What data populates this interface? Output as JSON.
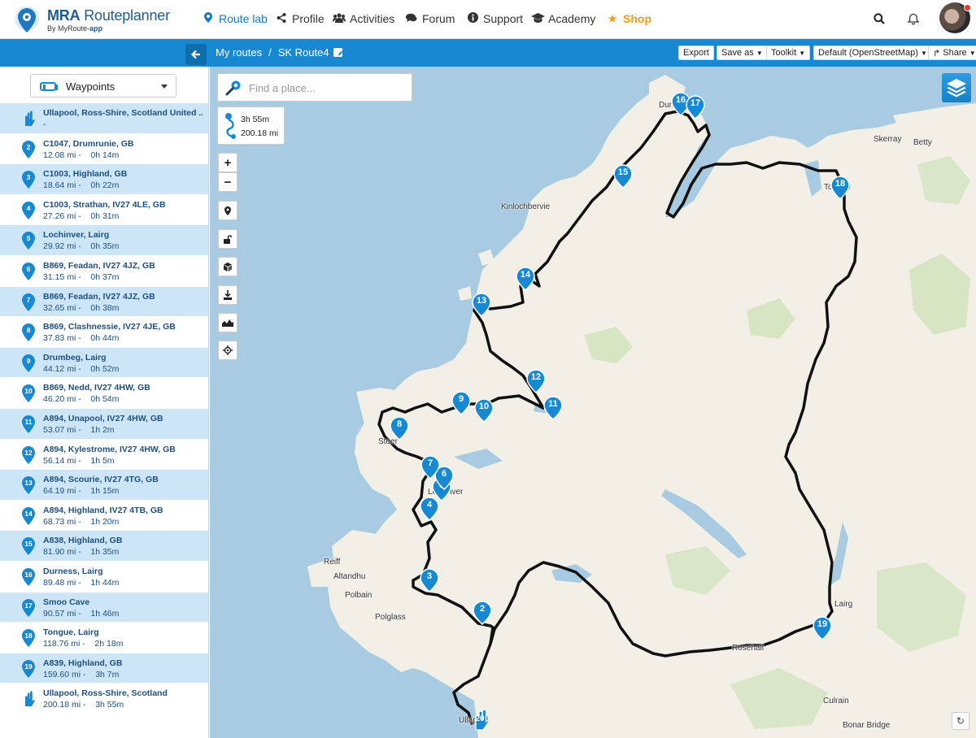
{
  "header": {
    "brand": "MRA",
    "brand_rest": "Routeplanner",
    "tagline_prefix": "By MyRoute-",
    "tagline_bold": "app",
    "nav": [
      {
        "label": "Route lab",
        "icon": "map-pin-icon"
      },
      {
        "label": "Profile",
        "icon": "share-icon"
      },
      {
        "label": "Activities",
        "icon": "group-icon"
      },
      {
        "label": "Forum",
        "icon": "chat-icon"
      },
      {
        "label": "Support",
        "icon": "info-icon"
      },
      {
        "label": "Academy",
        "icon": "graduation-cap-icon"
      },
      {
        "label": "Shop",
        "icon": "star-icon"
      }
    ],
    "right_icons": [
      "search-icon",
      "bell-icon",
      "avatar"
    ]
  },
  "toolbar": {
    "breadcrumb_root": "My routes",
    "breadcrumb_separator": "/",
    "route_name": "SK Route4",
    "export": "Export",
    "save_as": "Save as",
    "toolkit": "Toolkit",
    "map_style": "Default (OpenStreetMap)",
    "share": "Share"
  },
  "sidebar": {
    "selector_label": "Waypoints",
    "waypoints": [
      {
        "n": "1",
        "title": "Ullapool, Ross-Shire, Scotland United ...",
        "sub": "-",
        "type": "start"
      },
      {
        "n": "2",
        "title": "C1047, Drumrunie, GB",
        "sub": "12.08 mi -    0h 14m"
      },
      {
        "n": "3",
        "title": "C1003, Highland, GB",
        "sub": "18.64 mi -    0h 22m"
      },
      {
        "n": "4",
        "title": "C1003, Strathan, IV27 4LE, GB",
        "sub": "27.26 mi -    0h 31m"
      },
      {
        "n": "5",
        "title": "Lochinver, Lairg",
        "sub": "29.92 mi -    0h 35m"
      },
      {
        "n": "6",
        "title": "B869, Feadan, IV27 4JZ, GB",
        "sub": "31.15 mi -    0h 37m"
      },
      {
        "n": "7",
        "title": "B869, Feadan, IV27 4JZ, GB",
        "sub": "32.65 mi -    0h 38m"
      },
      {
        "n": "8",
        "title": "B869, Clashnessie, IV27 4JE, GB",
        "sub": "37.83 mi -    0h 44m"
      },
      {
        "n": "9",
        "title": "Drumbeg, Lairg",
        "sub": "44.12 mi -    0h 52m"
      },
      {
        "n": "10",
        "title": "B869, Nedd, IV27 4HW, GB",
        "sub": "46.20 mi -    0h 54m"
      },
      {
        "n": "11",
        "title": "A894, Unapool, IV27 4HW, GB",
        "sub": "53.07 mi -    1h 2m"
      },
      {
        "n": "12",
        "title": "A894, Kylestrome, IV27 4HW, GB",
        "sub": "56.14 mi -    1h 5m"
      },
      {
        "n": "13",
        "title": "A894, Scourie, IV27 4TG, GB",
        "sub": "64.19 mi -    1h 15m"
      },
      {
        "n": "14",
        "title": "A894, Highland, IV27 4TB, GB",
        "sub": "68.73 mi -    1h 20m"
      },
      {
        "n": "15",
        "title": "A838, Highland, GB",
        "sub": "81.90 mi -    1h 35m"
      },
      {
        "n": "16",
        "title": "Durness, Lairg",
        "sub": "89.48 mi -    1h 44m"
      },
      {
        "n": "17",
        "title": "Smoo Cave",
        "sub": "90.57 mi -    1h 46m"
      },
      {
        "n": "18",
        "title": "Tongue, Lairg",
        "sub": "118.76 mi -    2h 18m"
      },
      {
        "n": "19",
        "title": "A839, Highland, GB",
        "sub": "159.60 mi -    3h 7m"
      },
      {
        "n": "20",
        "title": "Ullapool, Ross-Shire, Scotland",
        "sub": "200.18 mi -    3h 55m",
        "type": "end"
      }
    ]
  },
  "map": {
    "search_placeholder": "Find a place...",
    "total_time": "3h 55m",
    "total_distance": "200.18 mi",
    "controls": [
      "zoom-in",
      "zoom-out",
      "add-waypoint",
      "unlock",
      "cube",
      "download",
      "elevation",
      "locate"
    ],
    "zoom_in": "+",
    "zoom_out": "−",
    "places": [
      "Kinlochbervie",
      "Durness",
      "Skerray",
      "Betty",
      "Tongue",
      "Stoer",
      "Lochinver",
      "Reiff",
      "Altandhu",
      "Polbain",
      "Polglass",
      "Lairg",
      "Rosehall",
      "Culrain",
      "Bonar Bridge",
      "Ullapool"
    ],
    "waypoint_labels": [
      "2",
      "3",
      "4",
      "5",
      "6",
      "7",
      "8",
      "9",
      "10",
      "11",
      "12",
      "13",
      "14",
      "15",
      "16",
      "17",
      "18",
      "19",
      "20"
    ]
  },
  "colors": {
    "accent": "#1789d3",
    "shop": "#f29a13",
    "sidebar_alt_row": "#cde6f7",
    "water": "#a9cbe1",
    "land": "#f2efe6",
    "route": "#111111"
  }
}
